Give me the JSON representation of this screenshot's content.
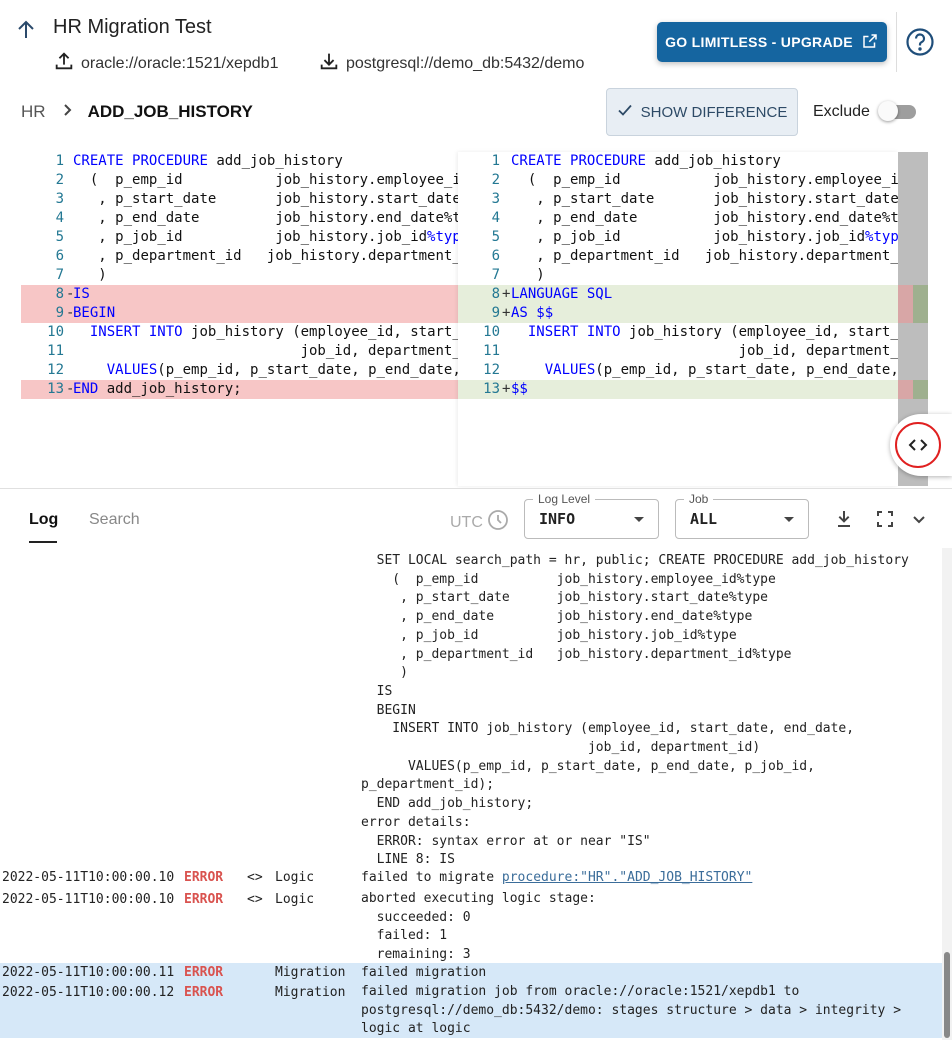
{
  "header": {
    "title": "HR Migration Test",
    "source": "oracle://oracle:1521/xepdb1",
    "target": "postgresql://demo_db:5432/demo",
    "upgrade_label": "GO LIMITLESS - UPGRADE"
  },
  "breadcrumb": {
    "schema": "HR",
    "object": "ADD_JOB_HISTORY"
  },
  "toolbar": {
    "show_difference_label": "SHOW DIFFERENCE",
    "exclude_label": "Exclude"
  },
  "diff": {
    "left": [
      {
        "n": "1",
        "type": "",
        "mark": "",
        "code": "CREATE PROCEDURE add_job_history"
      },
      {
        "n": "2",
        "type": "",
        "mark": "",
        "code": "  (  p_emp_id           job_history.employee_id"
      },
      {
        "n": "3",
        "type": "",
        "mark": "",
        "code": "   , p_start_date       job_history.start_date%"
      },
      {
        "n": "4",
        "type": "",
        "mark": "",
        "code": "   , p_end_date         job_history.end_date%typ"
      },
      {
        "n": "5",
        "type": "",
        "mark": "",
        "code": "   , p_job_id           job_history.job_id%type"
      },
      {
        "n": "6",
        "type": "",
        "mark": "",
        "code": "   , p_department_id   job_history.department_"
      },
      {
        "n": "7",
        "type": "",
        "mark": "",
        "code": "   )"
      },
      {
        "n": "8",
        "type": "del",
        "mark": "-",
        "code": "IS"
      },
      {
        "n": "9",
        "type": "del",
        "mark": "-",
        "code": "BEGIN"
      },
      {
        "n": "10",
        "type": "",
        "mark": "",
        "code": "  INSERT INTO job_history (employee_id, start_"
      },
      {
        "n": "11",
        "type": "",
        "mark": "",
        "code": "                           job_id, department_"
      },
      {
        "n": "12",
        "type": "",
        "mark": "",
        "code": "    VALUES(p_emp_id, p_start_date, p_end_date,"
      },
      {
        "n": "13",
        "type": "del",
        "mark": "-",
        "code": "END add_job_history;"
      }
    ],
    "right": [
      {
        "n": "1",
        "type": "",
        "mark": "",
        "code": "CREATE PROCEDURE add_job_history"
      },
      {
        "n": "2",
        "type": "",
        "mark": "",
        "code": "  (  p_emp_id           job_history.employee_id"
      },
      {
        "n": "3",
        "type": "",
        "mark": "",
        "code": "   , p_start_date       job_history.start_date%"
      },
      {
        "n": "4",
        "type": "",
        "mark": "",
        "code": "   , p_end_date         job_history.end_date%ty"
      },
      {
        "n": "5",
        "type": "",
        "mark": "",
        "code": "   , p_job_id           job_history.job_id%type"
      },
      {
        "n": "6",
        "type": "",
        "mark": "",
        "code": "   , p_department_id   job_history.department_"
      },
      {
        "n": "7",
        "type": "",
        "mark": "",
        "code": "   )"
      },
      {
        "n": "8",
        "type": "add",
        "mark": "+",
        "code": "LANGUAGE SQL"
      },
      {
        "n": "9",
        "type": "add",
        "mark": "+",
        "code": "AS $$"
      },
      {
        "n": "10",
        "type": "",
        "mark": "",
        "code": "  INSERT INTO job_history (employee_id, start_"
      },
      {
        "n": "11",
        "type": "",
        "mark": "",
        "code": "                           job_id, department_"
      },
      {
        "n": "12",
        "type": "",
        "mark": "",
        "code": "    VALUES(p_emp_id, p_start_date, p_end_date,"
      },
      {
        "n": "13",
        "type": "add",
        "mark": "+",
        "code": "$$"
      }
    ]
  },
  "logbar": {
    "tab_log": "Log",
    "tab_search": "Search",
    "utc": "UTC",
    "level_label": "Log Level",
    "level_value": "INFO",
    "job_label": "Job",
    "job_value": "ALL"
  },
  "logs": {
    "message_block": "  SET LOCAL search_path = hr, public; CREATE PROCEDURE add_job_history\n    (  p_emp_id          job_history.employee_id%type\n     , p_start_date      job_history.start_date%type\n     , p_end_date        job_history.end_date%type\n     , p_job_id          job_history.job_id%type\n     , p_department_id   job_history.department_id%type\n     )\n  IS\n  BEGIN\n    INSERT INTO job_history (employee_id, start_date, end_date,\n                             job_id, department_id)\n      VALUES(p_emp_id, p_start_date, p_end_date, p_job_id,\np_department_id);\n  END add_job_history;\nerror details:\n  ERROR: syntax error at or near \"IS\"\n  LINE 8: IS",
    "entries": [
      {
        "ts": "2022-05-11T10:00:00.10",
        "level": "ERROR",
        "icon": "<>",
        "source": "Logic",
        "msg_prefix": "failed to migrate ",
        "link": "procedure:\"HR\".\"ADD_JOB_HISTORY\"",
        "msg": ""
      },
      {
        "ts": "2022-05-11T10:00:00.10",
        "level": "ERROR",
        "icon": "<>",
        "source": "Logic",
        "msg_prefix": "",
        "link": "",
        "msg": "aborted executing logic stage:\n  succeeded: 0\n  failed: 1\n  remaining: 3"
      },
      {
        "ts": "2022-05-11T10:00:00.11",
        "level": "ERROR",
        "icon": "",
        "source": "Migration",
        "msg_prefix": "",
        "link": "",
        "msg": "failed migration"
      },
      {
        "ts": "2022-05-11T10:00:00.12",
        "level": "ERROR",
        "icon": "",
        "source": "Migration",
        "msg_prefix": "",
        "link": "",
        "msg": "failed migration job from oracle://oracle:1521/xepdb1 to\npostgresql://demo_db:5432/demo: stages structure > data > integrity >\nlogic at logic"
      }
    ]
  }
}
